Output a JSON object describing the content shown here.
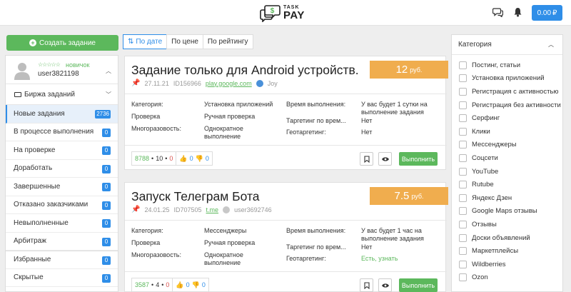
{
  "header": {
    "logo_small": "TASK",
    "logo_big": "PAY",
    "balance": "0.00"
  },
  "left": {
    "create_label": "Создать задание",
    "user": {
      "rank": "новичок",
      "name": "user3821198",
      "stars": "☆☆☆☆☆"
    },
    "exchange_label": "Биржа заданий",
    "menu": [
      {
        "label": "Новые задания",
        "count": "2736"
      },
      {
        "label": "В процессе выполнения",
        "count": "0"
      },
      {
        "label": "На проверке",
        "count": "0"
      },
      {
        "label": "Доработать",
        "count": "0"
      },
      {
        "label": "Завершенные",
        "count": "0"
      },
      {
        "label": "Отказано заказчиками",
        "count": "0"
      },
      {
        "label": "Невыполненные",
        "count": "0"
      },
      {
        "label": "Арбитраж",
        "count": "0"
      },
      {
        "label": "Избранные",
        "count": "0"
      },
      {
        "label": "Скрытые",
        "count": "0"
      }
    ]
  },
  "sort": {
    "by_date": "По дате",
    "by_price": "По цене",
    "by_rating": "По рейтингу"
  },
  "labels": {
    "category": "Категория:",
    "check": "Проверка",
    "repeat": "Многоразовость:",
    "exec_time": "Время выполнения:",
    "targeting": "Таргетинг по врем...",
    "geo": "Геотаргетинг:",
    "run": "Выполнить",
    "price_unit": "руб."
  },
  "tasks": [
    {
      "title": "Задание только для Android устройств.",
      "price": "12",
      "date": "27.11.21",
      "id": "ID156966",
      "link": "play.google.com",
      "author": "Joy",
      "category": "Установка приложений",
      "check": "Ручная проверка",
      "repeat": "Однократное выполнение",
      "exec_time": "У вас будет 1 сутки на выполнение задания",
      "targeting": "Нет",
      "geo": "Нет",
      "stat_total": "8788",
      "stat_done": "10",
      "stat_fail": "0",
      "likes": "0",
      "dislikes": "0"
    },
    {
      "title": "Запуск Телеграм Бота",
      "price": "7.5",
      "date": "24.01.25",
      "id": "ID707505",
      "link": "t.me",
      "author": "user3692746",
      "category": "Мессенджеры",
      "check": "Ручная проверка",
      "repeat": "Однократное выполнение",
      "exec_time": "У вас будет 1 час на выполнение задания",
      "targeting": "Нет",
      "geo": "Есть, узнать",
      "stat_total": "3587",
      "stat_done": "4",
      "stat_fail": "0",
      "likes": "0",
      "dislikes": "0"
    }
  ],
  "right": {
    "title": "Категория",
    "categories": [
      "Постинг, статьи",
      "Установка приложений",
      "Регистрация с активностью",
      "Регистрация без активности",
      "Серфинг",
      "Клики",
      "Мессенджеры",
      "Соцсети",
      "YouTube",
      "Rutube",
      "Яндекс Дзен",
      "Google Maps отзывы",
      "Отзывы",
      "Доски объявлений",
      "Маркетплейсы",
      "Wildberries",
      "Ozon"
    ]
  }
}
